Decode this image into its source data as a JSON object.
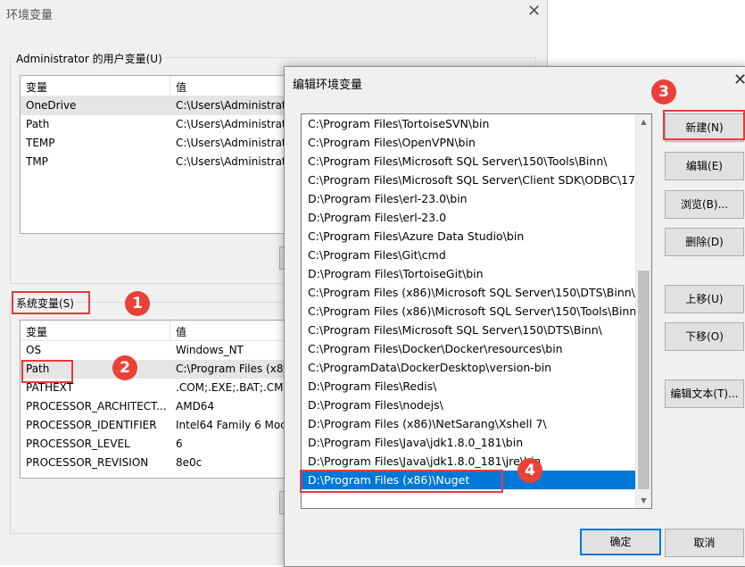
{
  "env_dialog": {
    "title": "环境变量",
    "close_glyph": "✕",
    "user_group": {
      "legend": "Administrator 的用户变量(U)",
      "header_var": "变量",
      "header_val": "值",
      "rows": [
        {
          "var": "OneDrive",
          "val": "C:\\Users\\Administrat"
        },
        {
          "var": "Path",
          "val": "C:\\Users\\Administrat"
        },
        {
          "var": "TEMP",
          "val": "C:\\Users\\Administrat"
        },
        {
          "var": "TMP",
          "val": "C:\\Users\\Administrat"
        }
      ]
    },
    "system_group": {
      "legend": "系统变量(S)",
      "header_var": "变量",
      "header_val": "值",
      "rows": [
        {
          "var": "OS",
          "val": "Windows_NT"
        },
        {
          "var": "Path",
          "val": "C:\\Program Files (x86"
        },
        {
          "var": "PATHEXT",
          "val": ".COM;.EXE;.BAT;.CMD"
        },
        {
          "var": "PROCESSOR_ARCHITECT...",
          "val": "AMD64"
        },
        {
          "var": "PROCESSOR_IDENTIFIER",
          "val": "Intel64 Family 6 Mod"
        },
        {
          "var": "PROCESSOR_LEVEL",
          "val": "6"
        },
        {
          "var": "PROCESSOR_REVISION",
          "val": "8e0c"
        }
      ]
    }
  },
  "edit_dialog": {
    "title": "编辑环境变量",
    "close_glyph": "✕",
    "paths": [
      "C:\\Program Files\\TortoiseSVN\\bin",
      "C:\\Program Files\\OpenVPN\\bin",
      "C:\\Program Files\\Microsoft SQL Server\\150\\Tools\\Binn\\",
      "C:\\Program Files\\Microsoft SQL Server\\Client SDK\\ODBC\\17...",
      "D:\\Program Files\\erl-23.0\\bin",
      "D:\\Program Files\\erl-23.0",
      "C:\\Program Files\\Azure Data Studio\\bin",
      "C:\\Program Files\\Git\\cmd",
      "D:\\Program Files\\TortoiseGit\\bin",
      "C:\\Program Files (x86)\\Microsoft SQL Server\\150\\DTS\\Binn\\",
      "C:\\Program Files (x86)\\Microsoft SQL Server\\150\\Tools\\Binn\\",
      "C:\\Program Files\\Microsoft SQL Server\\150\\DTS\\Binn\\",
      "C:\\Program Files\\Docker\\Docker\\resources\\bin",
      "C:\\ProgramData\\DockerDesktop\\version-bin",
      "D:\\Program Files\\Redis\\",
      "D:\\Program Files\\nodejs\\",
      "D:\\Program Files (x86)\\NetSarang\\Xshell 7\\",
      "D:\\Program Files\\Java\\jdk1.8.0_181\\bin",
      "D:\\Program Files\\Java\\jdk1.8.0_181\\jre\\bin",
      "D:\\Program Files (x86)\\Nuget"
    ],
    "selected_index": 19,
    "buttons": {
      "new": "新建(N)",
      "edit": "编辑(E)",
      "browse": "浏览(B)...",
      "delete": "删除(D)",
      "move_up": "上移(U)",
      "move_down": "下移(O)",
      "edit_text": "编辑文本(T)...",
      "ok": "确定",
      "cancel": "取消"
    },
    "scroll_up_glyph": "▲",
    "scroll_down_glyph": "▼"
  },
  "annotations": {
    "step1": "1",
    "step2": "2",
    "step3": "3",
    "step4": "4"
  },
  "colors": {
    "selection": "#0078d7",
    "annotation_red": "#e63a3a",
    "dialog_bg": "#f0f0f0"
  }
}
